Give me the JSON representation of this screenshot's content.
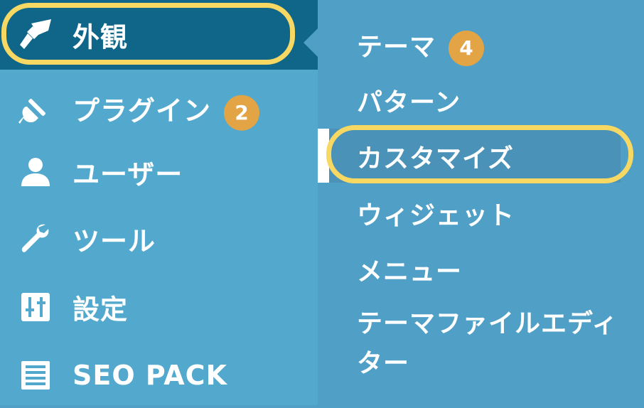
{
  "sidebar": {
    "items": [
      {
        "label": "外観",
        "icon": "paintbrush-icon",
        "active": true
      },
      {
        "label": "プラグイン",
        "icon": "plugin-icon",
        "badge": "2"
      },
      {
        "label": "ユーザー",
        "icon": "user-icon"
      },
      {
        "label": "ツール",
        "icon": "wrench-icon"
      },
      {
        "label": "設定",
        "icon": "settings-sliders-icon"
      },
      {
        "label": "SEO PACK",
        "icon": "list-icon"
      }
    ]
  },
  "submenu": {
    "items": [
      {
        "label": "テーマ",
        "badge": "4"
      },
      {
        "label": "パターン"
      },
      {
        "label": "カスタマイズ",
        "current": true
      },
      {
        "label": "ウィジェット"
      },
      {
        "label": "メニュー"
      },
      {
        "label": "テーマファイルエディター"
      }
    ]
  },
  "colors": {
    "sidebar_bg": "#52a8cd",
    "active_bg": "#0f6689",
    "submenu_bg": "#4f9fc6",
    "badge": "#e3a445",
    "highlight": "#f6d862"
  }
}
